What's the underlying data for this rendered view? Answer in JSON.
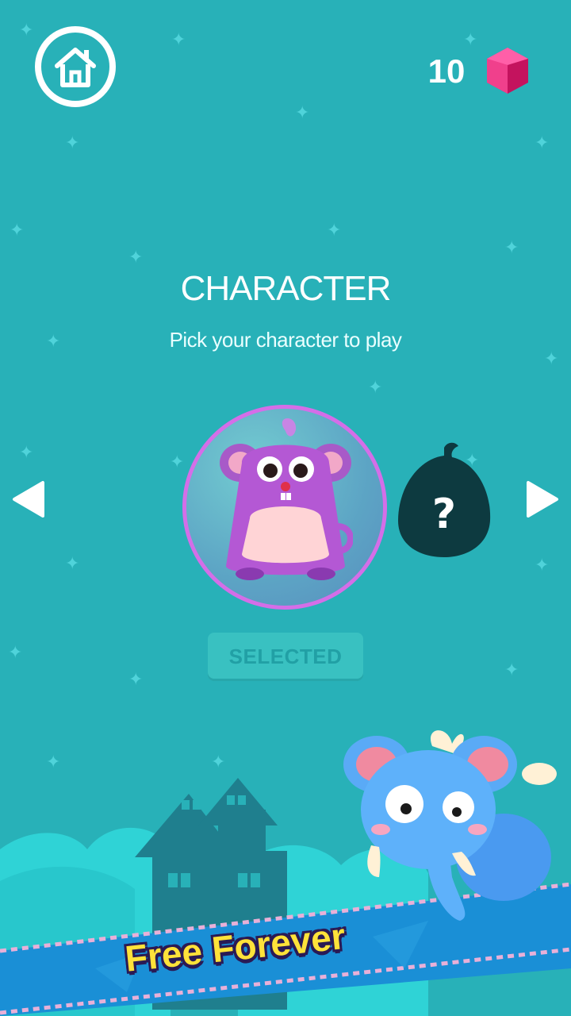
{
  "header": {
    "home_icon": "home-icon",
    "gem_count": "10",
    "gem_icon": "pink-gem-icon"
  },
  "screen": {
    "title": "CHARACTER",
    "subtitle": "Pick your character to play"
  },
  "carousel": {
    "prev_icon": "left-arrow-icon",
    "next_icon": "right-arrow-icon",
    "current_character": "purple-hamster-character",
    "locked_character_mark": "?",
    "select_button_label": "SELECTED"
  },
  "promo": {
    "banner_text": "Free Forever",
    "mascot": "blue-elephant-mascot"
  },
  "colors": {
    "background": "#28b1b8",
    "accent_pink": "#e8247a",
    "banner_text": "#ffe23a",
    "banner_stripe": "#1a8fd6"
  }
}
